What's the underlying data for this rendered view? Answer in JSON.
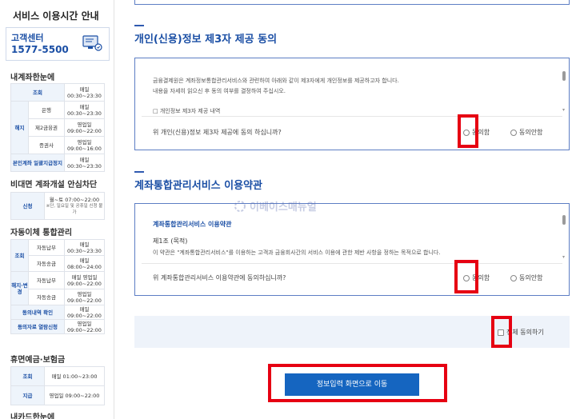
{
  "sidebar": {
    "title": "서비스 이용시간 안내",
    "customer_center": {
      "label": "고객센터",
      "phone": "1577-5500"
    },
    "sections": [
      {
        "title": "내계좌한눈에",
        "rows": [
          {
            "cat": "",
            "sub": "조회",
            "time": "매일 00:30~23:30"
          },
          {
            "cat": "해지",
            "sub": "은행",
            "time": "매일 00:30~23:30"
          },
          {
            "cat": "",
            "sub": "제2금융권",
            "time": "영업일 09:00~22:00"
          },
          {
            "cat": "",
            "sub": "증권사",
            "time": "영업일 09:00~16:00"
          },
          {
            "cat": "",
            "sub": "본인계좌 일괄지급정지",
            "time": "매일 00:30~23:30"
          }
        ]
      },
      {
        "title": "비대면 계좌개설 안심차단",
        "rows": [
          {
            "cat": "",
            "sub": "신청",
            "time": "월~토 07:00~22:00",
            "note": "※단, 일요일 및 공휴일 신청 불가"
          }
        ]
      },
      {
        "title": "자동이체 통합관리",
        "rows": [
          {
            "cat": "조회",
            "sub": "자동납부",
            "time": "매일 00:30~23:30"
          },
          {
            "cat": "",
            "sub": "자동송금",
            "time": "매일 08:00~24:00"
          },
          {
            "cat": "해지·변경",
            "sub": "자동납부",
            "time": "매일 영업일 09:00~22:00"
          },
          {
            "cat": "",
            "sub": "자동송금",
            "time": "영업일 09:00~22:00"
          },
          {
            "cat": "",
            "sub": "동의내역 확인",
            "time": "매일 09:00~22:00"
          },
          {
            "cat": "",
            "sub": "동의자료 열람신청",
            "time": "영업일 09:00~22:00"
          }
        ]
      },
      {
        "title": "휴면예금·보험금",
        "rows": [
          {
            "cat": "",
            "sub": "조회",
            "time": "매일 01:00~23:00"
          },
          {
            "cat": "",
            "sub": "지급",
            "time": "영업일 09:00~22:00"
          }
        ]
      },
      {
        "title": "내카드한눈에",
        "rows": []
      }
    ]
  },
  "main": {
    "section1": {
      "title": "개인(신용)정보 제3자 제공 동의",
      "body_line1": "금융결제원은 계좌정보통합관리서비스와 관련하여 아래와 같이 제3자에게 개인정보를 제공하고자 합니다.",
      "body_line2": "내용을 자세히 읽으신 후 동의 여부를 결정하여 주십시오.",
      "body_line3": "□ 개인정보 제3자 제공 내역",
      "question": "위 개인(신용)정보 제3자 제공에 동의 하십니까?",
      "agree_label": "동의함",
      "disagree_label": "동의안함"
    },
    "section2": {
      "title": "계좌통합관리서비스 이용약관",
      "inner_title": "계좌통합관리서비스 이용약관",
      "article_title": "제1조 (목적)",
      "article_text": "이 약관은 \"계좌통합관리서비스\"를 이용하는 고객과 금융회사간의 서비스 이용에 관한 제반 사항을 정하는 목적으로 합니다.",
      "question": "위 계좌통합관리서비스 이용약관에 동의하십니까?",
      "agree_label": "동의함",
      "disagree_label": "동의안함"
    },
    "agree_all_label": "전체 동의하기",
    "submit_label": "정보입력 화면으로 이동"
  },
  "watermark": {
    "text": "이베이스매뉴얼"
  },
  "colors": {
    "accent": "#1b4fa5",
    "button": "#1565c0",
    "highlight": "#e60012",
    "panel_border": "#5d7ec4"
  }
}
